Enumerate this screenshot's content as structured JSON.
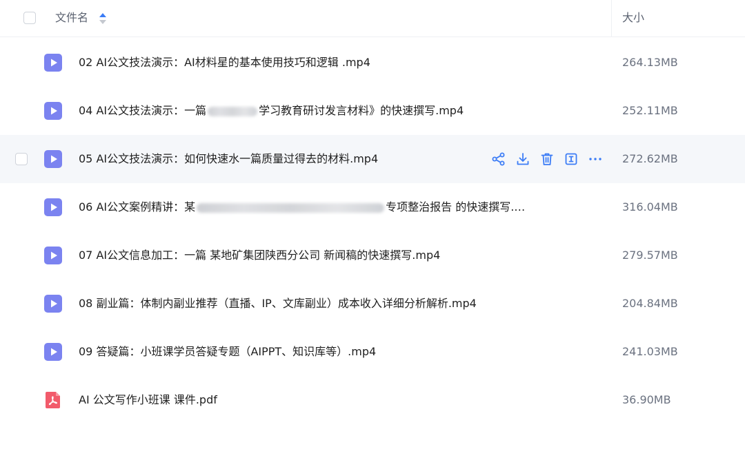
{
  "header": {
    "name_label": "文件名",
    "size_label": "大小"
  },
  "colors": {
    "video_icon": "#7b83f0",
    "pdf_icon": "#f25b6b",
    "action_icon": "#3b7cf6",
    "hover_row": "#f5f7fa"
  },
  "files": [
    {
      "name": "02 AI公文技法演示：AI材料星的基本使用技巧和逻辑 .mp4",
      "size": "264.13MB",
      "type": "video"
    },
    {
      "name_pre": "04 AI公文技法演示：一篇",
      "name_post": "学习教育研讨发言材料》的快速撰写.mp4",
      "size": "252.11MB",
      "type": "video"
    },
    {
      "name": "05 AI公文技法演示：如何快速水一篇质量过得去的材料.mp4",
      "size": "272.62MB",
      "type": "video"
    },
    {
      "name_pre": "06 AI公文案例精讲：某",
      "name_post": "专项整治报告 的快速撰写.…",
      "size": "316.04MB",
      "type": "video"
    },
    {
      "name": "07 AI公文信息加工：一篇 某地矿集团陕西分公司 新闻稿的快速撰写.mp4",
      "size": "279.57MB",
      "type": "video"
    },
    {
      "name": "08 副业篇：体制内副业推荐（直播、IP、文库副业）成本收入详细分析解析.mp4",
      "size": "204.84MB",
      "type": "video"
    },
    {
      "name": "09 答疑篇：小班课学员答疑专题（AIPPT、知识库等）.mp4",
      "size": "241.03MB",
      "type": "video"
    },
    {
      "name": "AI 公文写作小班课 课件.pdf",
      "size": "36.90MB",
      "type": "pdf"
    }
  ],
  "row_actions": [
    "share-icon",
    "download-icon",
    "delete-icon",
    "rename-icon",
    "more-icon"
  ]
}
